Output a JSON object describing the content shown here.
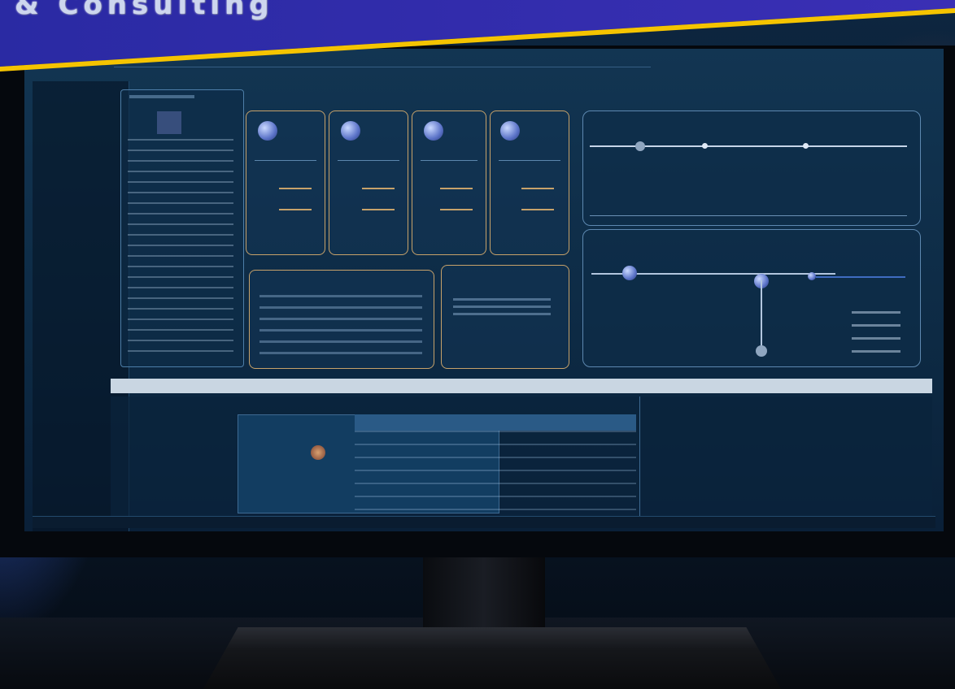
{
  "banner": {
    "brand_text": "& Consulting",
    "background": "#2b27a8",
    "stripe_color": "#f5c400"
  },
  "screen": {
    "accent": "#c7a26a",
    "line_color": "#9fb6d4",
    "node_color": "#5b73c8"
  },
  "colors": {
    "left_glow": "#4a6cff",
    "right_glow": "#c0462d"
  }
}
